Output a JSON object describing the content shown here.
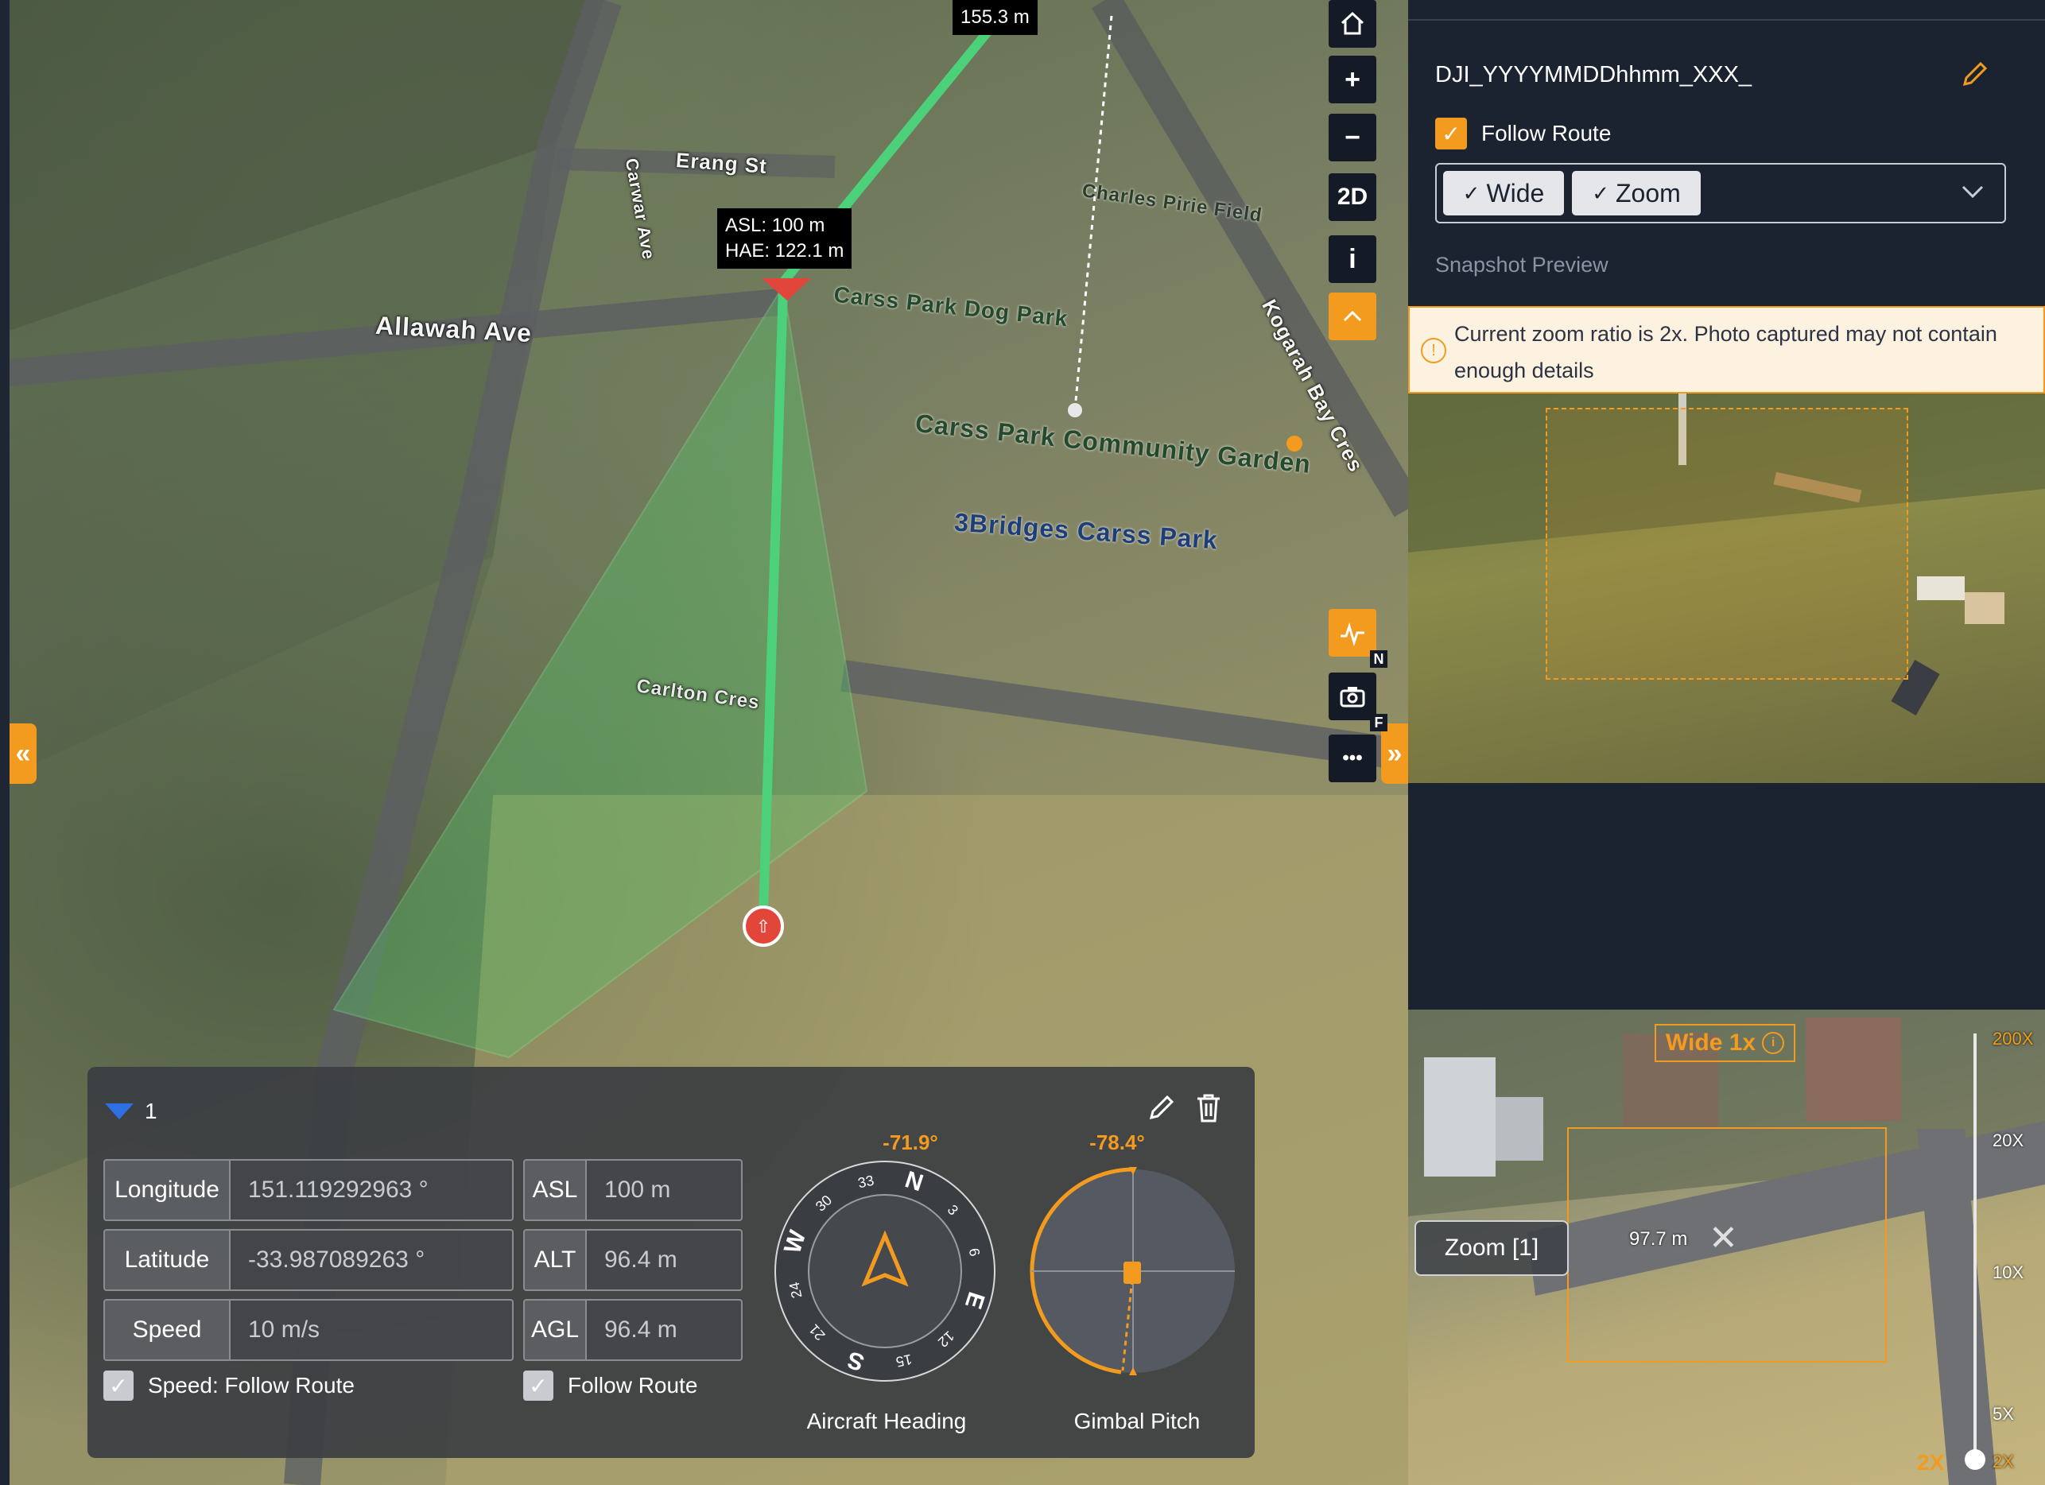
{
  "map": {
    "distance_label": "155.3 m",
    "altitude_tag": {
      "asl": "ASL: 100 m",
      "hae": "HAE: 122.1 m"
    },
    "place_labels": [
      "Erang St",
      "Carwar Ave",
      "Allawah Ave",
      "Charles Pirie Field",
      "Carss Park Dog Park",
      "Carss Park Community Garden",
      "3Bridges Carss Park",
      "Carlton Cres",
      "Kogarah Bay Cres"
    ],
    "toolbar": {
      "home_icon": "home-icon",
      "zoom_in": "+",
      "zoom_out": "−",
      "view_mode": "2D",
      "info": "i",
      "collapse": "^",
      "chart_badge": "N",
      "camera_badge": "F",
      "more": "•••"
    },
    "left_toggle": "«",
    "right_toggle": "»"
  },
  "waypoint": {
    "index": "1",
    "longitude": {
      "label": "Longitude",
      "value": "151.119292963 °"
    },
    "latitude": {
      "label": "Latitude",
      "value": "-33.987089263 °"
    },
    "speed": {
      "label": "Speed",
      "value": "10 m/s"
    },
    "asl": {
      "label": "ASL",
      "value": "100 m"
    },
    "alt": {
      "label": "ALT",
      "value": "96.4 m"
    },
    "agl": {
      "label": "AGL",
      "value": "96.4 m"
    },
    "speed_follow": "Speed: Follow Route",
    "alt_follow": "Follow Route",
    "heading": {
      "value": "-71.9°",
      "label": "Aircraft Heading",
      "ticks": [
        "W",
        "30",
        "33",
        "N",
        "3",
        "6",
        "E",
        "12",
        "15",
        "S",
        "21",
        "24"
      ]
    },
    "gimbal": {
      "value": "-78.4°",
      "label": "Gimbal Pitch"
    }
  },
  "panel": {
    "file_name": "DJI_YYYYMMDDhhmm_XXX_",
    "follow_route": "Follow Route",
    "lenses": [
      "Wide",
      "Zoom"
    ],
    "snapshot_label": "Snapshot Preview",
    "warning": "Current zoom ratio is 2x. Photo captured may not contain enough details",
    "camera": {
      "wide_badge": "Wide 1x",
      "zoom_button": "Zoom [1]",
      "distance": "97.7 m",
      "zoom_levels": [
        "200X",
        "20X",
        "10X",
        "5X",
        "2X"
      ],
      "current_zoom": "2X"
    }
  },
  "colors": {
    "accent": "#f29b1f",
    "route": "#4cd07a",
    "panel_bg": "#1b2230"
  }
}
